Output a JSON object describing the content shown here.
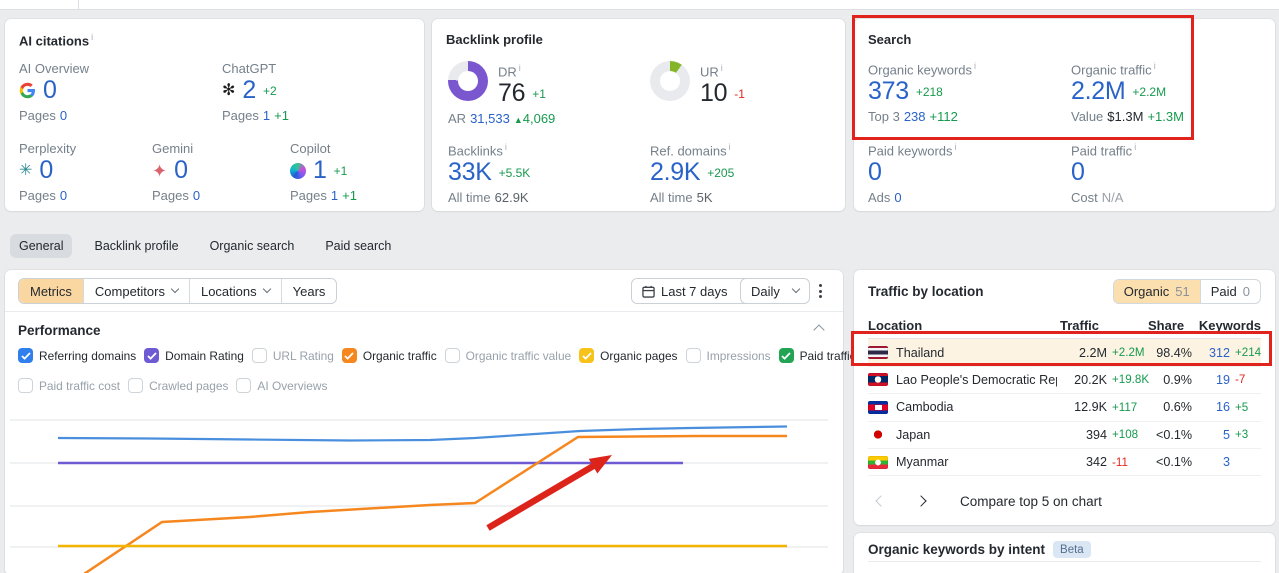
{
  "ai_citations": {
    "title": "AI citations",
    "engines": [
      {
        "name": "AI Overview",
        "icon": "google",
        "value": "0",
        "change": "",
        "pages_label": "Pages",
        "pages": "0",
        "pages_change": ""
      },
      {
        "name": "ChatGPT",
        "icon": "chatgpt",
        "value": "2",
        "change": "+2",
        "pages_label": "Pages",
        "pages": "1",
        "pages_change": "+1"
      },
      {
        "name": "Perplexity",
        "icon": "perplexity",
        "value": "0",
        "change": "",
        "pages_label": "Pages",
        "pages": "0",
        "pages_change": ""
      },
      {
        "name": "Gemini",
        "icon": "gemini",
        "value": "0",
        "change": "",
        "pages_label": "Pages",
        "pages": "0",
        "pages_change": ""
      },
      {
        "name": "Copilot",
        "icon": "copilot",
        "value": "1",
        "change": "+1",
        "pages_label": "Pages",
        "pages": "1",
        "pages_change": "+1"
      }
    ]
  },
  "backlink_profile": {
    "title": "Backlink profile",
    "dr": {
      "label": "DR",
      "value": "76",
      "change": "+1",
      "percent": 76,
      "color": "#7a57cf"
    },
    "ar": {
      "label": "AR",
      "value": "31,533",
      "change": "4,069"
    },
    "ur": {
      "label": "UR",
      "value": "10",
      "change": "-1",
      "percent": 10,
      "color": "#85b62a"
    },
    "backlinks": {
      "label": "Backlinks",
      "value": "33K",
      "change": "+5.5K",
      "alltime_label": "All time",
      "alltime": "62.9K"
    },
    "ref_domains": {
      "label": "Ref. domains",
      "value": "2.9K",
      "change": "+205",
      "alltime_label": "All time",
      "alltime": "5K"
    }
  },
  "search": {
    "title": "Search",
    "organic_keywords": {
      "label": "Organic keywords",
      "value": "373",
      "change": "+218",
      "sub_label": "Top 3",
      "sub_value": "238",
      "sub_change": "+112"
    },
    "organic_traffic": {
      "label": "Organic traffic",
      "value": "2.2M",
      "change": "+2.2M",
      "sub_label": "Value",
      "sub_value": "$1.3M",
      "sub_change": "+1.3M"
    },
    "paid_keywords": {
      "label": "Paid keywords",
      "value": "0",
      "change": "",
      "sub_label": "Ads",
      "sub_value": "0",
      "sub_change": ""
    },
    "paid_traffic": {
      "label": "Paid traffic",
      "value": "0",
      "change": "",
      "sub_label": "Cost",
      "sub_value": "N/A",
      "sub_change": ""
    }
  },
  "tabs": {
    "items": [
      "General",
      "Backlink profile",
      "Organic search",
      "Paid search"
    ],
    "selected": "General"
  },
  "controls": {
    "metrics": "Metrics",
    "competitors": "Competitors",
    "locations": "Locations",
    "years": "Years",
    "date_range": "Last 7 days",
    "granularity": "Daily"
  },
  "performance": {
    "title": "Performance",
    "checkboxes_row1": [
      {
        "label": "Referring domains",
        "checked": true,
        "color": "#2f80ed"
      },
      {
        "label": "Domain Rating",
        "checked": true,
        "color": "#6e5bd4"
      },
      {
        "label": "URL Rating",
        "checked": false
      },
      {
        "label": "Organic traffic",
        "checked": true,
        "color": "#f6871f"
      },
      {
        "label": "Organic traffic value",
        "checked": false
      },
      {
        "label": "Organic pages",
        "checked": true,
        "color": "#f7c21a"
      },
      {
        "label": "Impressions",
        "checked": false
      },
      {
        "label": "Paid traffic",
        "checked": true,
        "color": "#23a455"
      }
    ],
    "checkboxes_row2": [
      {
        "label": "Paid traffic cost",
        "checked": false
      },
      {
        "label": "Crawled pages",
        "checked": false
      },
      {
        "label": "AI Overviews",
        "checked": false
      }
    ]
  },
  "performance_chart": {
    "type": "line",
    "grid_y": [
      20,
      63,
      106,
      147
    ],
    "series": [
      {
        "name": "Referring domains",
        "color": "#4a8fdd",
        "width": 2.2,
        "points": [
          [
            53,
            38
          ],
          [
            145,
            38.5
          ],
          [
            245,
            39.5
          ],
          [
            345,
            40.5
          ],
          [
            425,
            40
          ],
          [
            470,
            38
          ],
          [
            515,
            35
          ],
          [
            575,
            31
          ],
          [
            635,
            29
          ],
          [
            685,
            28
          ],
          [
            782,
            26.5
          ]
        ]
      },
      {
        "name": "Domain Rating",
        "color": "#6e5bd4",
        "width": 2.5,
        "points": [
          [
            53,
            63
          ],
          [
            678,
            63
          ]
        ]
      },
      {
        "name": "Organic traffic",
        "color": "#f6871f",
        "width": 2.5,
        "points": [
          [
            73,
            178
          ],
          [
            157,
            122
          ],
          [
            245,
            117
          ],
          [
            305,
            112
          ],
          [
            425,
            105
          ],
          [
            470,
            103
          ],
          [
            573,
            37
          ],
          [
            695,
            36
          ],
          [
            782,
            36
          ]
        ]
      },
      {
        "name": "Organic pages",
        "color": "#f2b500",
        "width": 2.5,
        "points": [
          [
            53,
            146
          ],
          [
            782,
            146
          ]
        ]
      }
    ],
    "annotation_arrow": {
      "from": [
        483,
        128
      ],
      "to": [
        607,
        55
      ],
      "color": "#dd241b"
    }
  },
  "traffic_by_location": {
    "title": "Traffic by location",
    "toggle": {
      "organic_label": "Organic",
      "organic_count": "51",
      "paid_label": "Paid",
      "paid_count": "0"
    },
    "columns": [
      "Location",
      "Traffic",
      "Share",
      "Keywords"
    ],
    "rows": [
      {
        "flag": "thailand",
        "name": "Thailand",
        "traffic": "2.2M",
        "traffic_change": "+2.2M",
        "share": "98.4%",
        "keywords": "312",
        "kw_change": "+214",
        "highlight": true
      },
      {
        "flag": "laos",
        "name": "Lao People's Democratic Reput",
        "traffic": "20.2K",
        "traffic_change": "+19.8K",
        "share": "0.9%",
        "keywords": "19",
        "kw_change": "-7",
        "highlight": false
      },
      {
        "flag": "cambodia",
        "name": "Cambodia",
        "traffic": "12.9K",
        "traffic_change": "+117",
        "share": "0.6%",
        "keywords": "16",
        "kw_change": "+5",
        "highlight": false
      },
      {
        "flag": "japan",
        "name": "Japan",
        "traffic": "394",
        "traffic_change": "+108",
        "share": "<0.1%",
        "keywords": "5",
        "kw_change": "+3",
        "highlight": false
      },
      {
        "flag": "myanmar",
        "name": "Myanmar",
        "traffic": "342",
        "traffic_change": "-11",
        "share": "<0.1%",
        "keywords": "3",
        "kw_change": "",
        "highlight": false
      }
    ],
    "pagination_label": "Compare top 5 on chart"
  },
  "intent": {
    "title": "Organic keywords by intent",
    "badge": "Beta"
  }
}
